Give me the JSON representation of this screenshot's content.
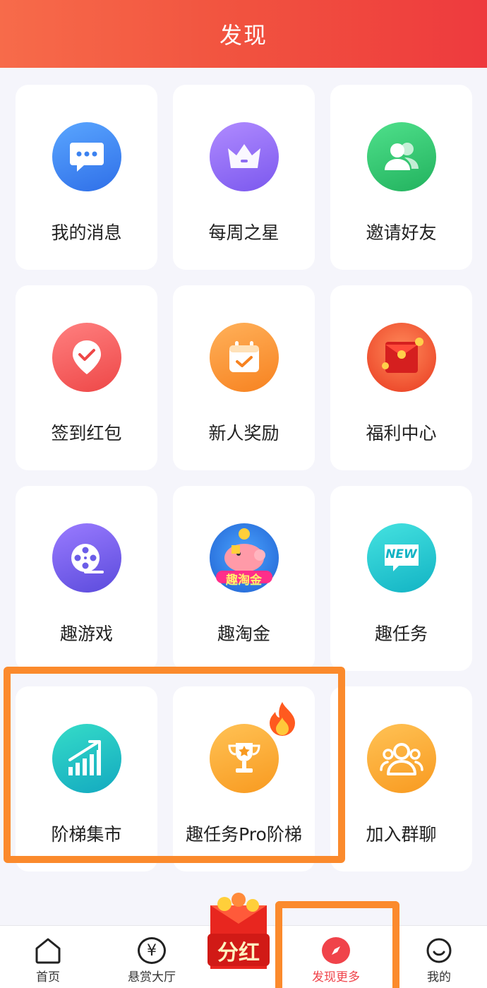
{
  "header": {
    "title": "发现"
  },
  "grid": {
    "items": [
      {
        "label": "我的消息",
        "icon": "message-icon",
        "color": "#3b82f0"
      },
      {
        "label": "每周之星",
        "icon": "crown-icon",
        "color": "#8d6df2"
      },
      {
        "label": "邀请好友",
        "icon": "friends-icon",
        "color": "#2fc46e"
      },
      {
        "label": "签到红包",
        "icon": "checkin-icon",
        "color": "#f25a5a"
      },
      {
        "label": "新人奖励",
        "icon": "calendar-icon",
        "color": "#fb8a2c"
      },
      {
        "label": "福利中心",
        "icon": "red-envelope-icon",
        "color": "#e2322b"
      },
      {
        "label": "趣游戏",
        "icon": "film-reel-icon",
        "color": "#6b5de8"
      },
      {
        "label": "趣淘金",
        "icon": "piggy-bank-icon",
        "color": "#2a7be0",
        "badge": "趣淘金"
      },
      {
        "label": "趣任务",
        "icon": "new-badge-icon",
        "color": "#1fc6c9",
        "badge": "NEW"
      },
      {
        "label": "阶梯集市",
        "icon": "growth-chart-icon",
        "color": "#21c6c9"
      },
      {
        "label": "趣任务Pro阶梯",
        "icon": "trophy-icon",
        "color": "#fba52d"
      },
      {
        "label": "加入群聊",
        "icon": "group-icon",
        "color": "#fba52d"
      }
    ]
  },
  "tabbar": {
    "items": [
      {
        "label": "首页",
        "icon": "home-icon"
      },
      {
        "label": "悬赏大厅",
        "icon": "yuan-coin-icon",
        "symbol": "¥"
      },
      {
        "label": "分红",
        "icon": "dividend-red-envelope-icon"
      },
      {
        "label": "发现更多",
        "icon": "compass-icon",
        "active": true
      },
      {
        "label": "我的",
        "icon": "smile-icon"
      }
    ]
  },
  "colors": {
    "accent": "#f0434a",
    "highlight": "#fb8a2c"
  }
}
